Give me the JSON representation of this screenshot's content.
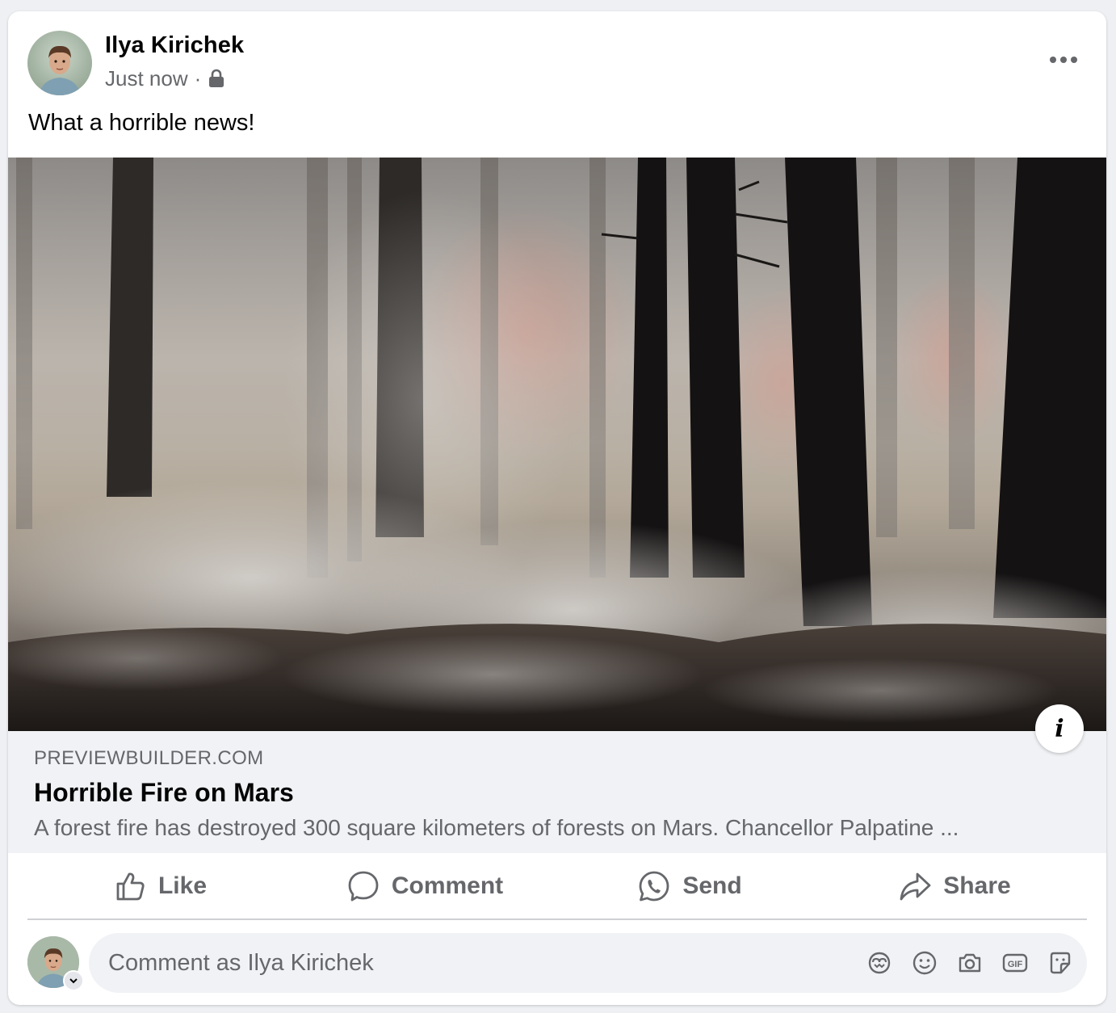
{
  "post": {
    "author_name": "Ilya Kirichek",
    "timestamp": "Just now",
    "separator": "·",
    "privacy_icon": "lock-icon",
    "text": "What a horrible news!"
  },
  "link_preview": {
    "domain": "PREVIEWBUILDER.COM",
    "title": "Horrible Fire on Mars",
    "description": "A forest fire has destroyed 300 square kilometers of forests on Mars. Chancellor Palpatine ...",
    "info_label": "i"
  },
  "actions": {
    "like_label": "Like",
    "comment_label": "Comment",
    "send_label": "Send",
    "share_label": "Share"
  },
  "comment": {
    "placeholder": "Comment as Ilya Kirichek",
    "icons": [
      "avatar-sticker-icon",
      "emoji-icon",
      "camera-icon",
      "gif-icon",
      "sticker-icon"
    ]
  },
  "colors": {
    "text_primary": "#050505",
    "text_secondary": "#65676b",
    "surface": "#ffffff",
    "link_background": "#f0f2f5",
    "page_background": "#eef0f3"
  }
}
